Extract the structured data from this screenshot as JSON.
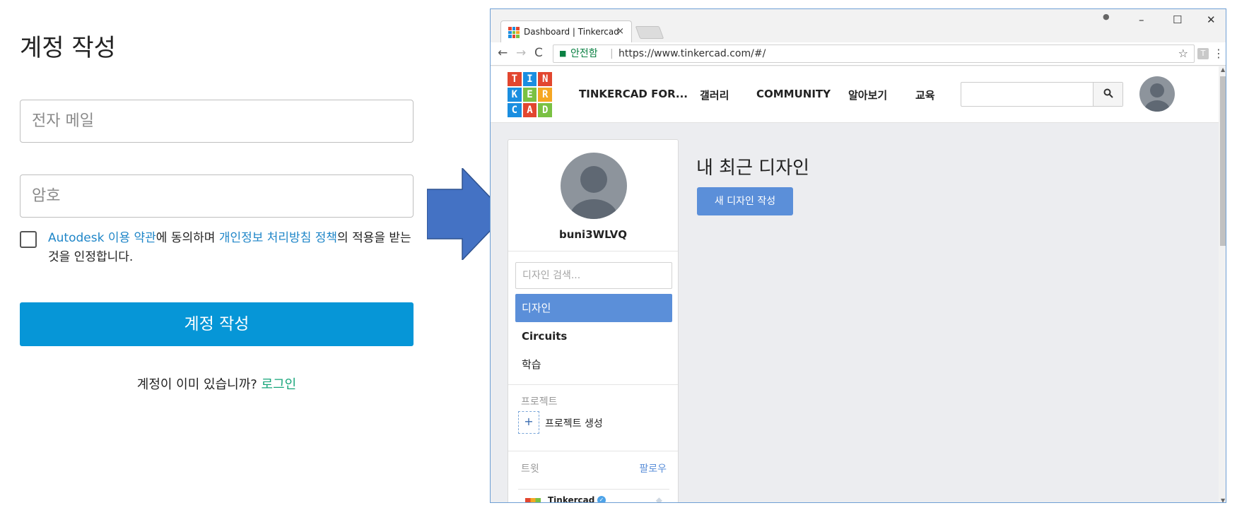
{
  "signup": {
    "title": "계정 작성",
    "email_placeholder": "전자 메일",
    "password_placeholder": "암호",
    "terms": {
      "link1": "Autodesk 이용 약관",
      "text1": "에 동의하며 ",
      "link2": "개인정보 처리방침 정책",
      "text2": "의 적용을 받는 것을 인정합니다."
    },
    "button": "계정 작성",
    "login_prompt": "계정이 이미 있습니까? ",
    "login_link": "로그인"
  },
  "browser": {
    "tab_title": "Dashboard | Tinkercad",
    "tab_close": "×",
    "window_controls": {
      "minimize": "–",
      "maximize": "☐",
      "close": "✕"
    },
    "secure_label": "안전함",
    "url": "https://www.tinkercad.com/#/",
    "ext_icon_letter": "T",
    "icons": [
      "back-arrow-icon",
      "forward-arrow-icon",
      "reload-icon",
      "lock-icon",
      "star-icon",
      "menu-dots-icon"
    ]
  },
  "site": {
    "logo_letters": [
      "T",
      "I",
      "N",
      "K",
      "E",
      "R",
      "C",
      "A",
      "D"
    ],
    "logo_colors": [
      "#e2462f",
      "#1a8ee0",
      "#e2462f",
      "#1a8ee0",
      "#7ac143",
      "#f5a623",
      "#1a8ee0",
      "#e2462f",
      "#7ac143"
    ],
    "nav": [
      "TINKERCAD FOR...",
      "갤러리",
      "COMMUNITY",
      "알아보기",
      "교육"
    ],
    "search_value": ""
  },
  "sidebar": {
    "username": "buni3WLVQ",
    "search_placeholder": "디자인 검색...",
    "items": [
      "디자인",
      "Circuits",
      "학습"
    ],
    "projects_label": "프로젝트",
    "create_project_icon": "+",
    "create_project": "프로젝트 생성",
    "tweets_label": "트윗",
    "follow": "팔로우",
    "tweet_account": "Tinkercad"
  },
  "main": {
    "title": "내 최근 디자인",
    "new_design_button": "새 디자인 작성"
  },
  "colors": {
    "signup_button": "#0696d7",
    "link": "#1f86c8",
    "login_link": "#17a57a",
    "arrow": "#4472c4",
    "tinkercad_accent": "#5b8fd9"
  }
}
